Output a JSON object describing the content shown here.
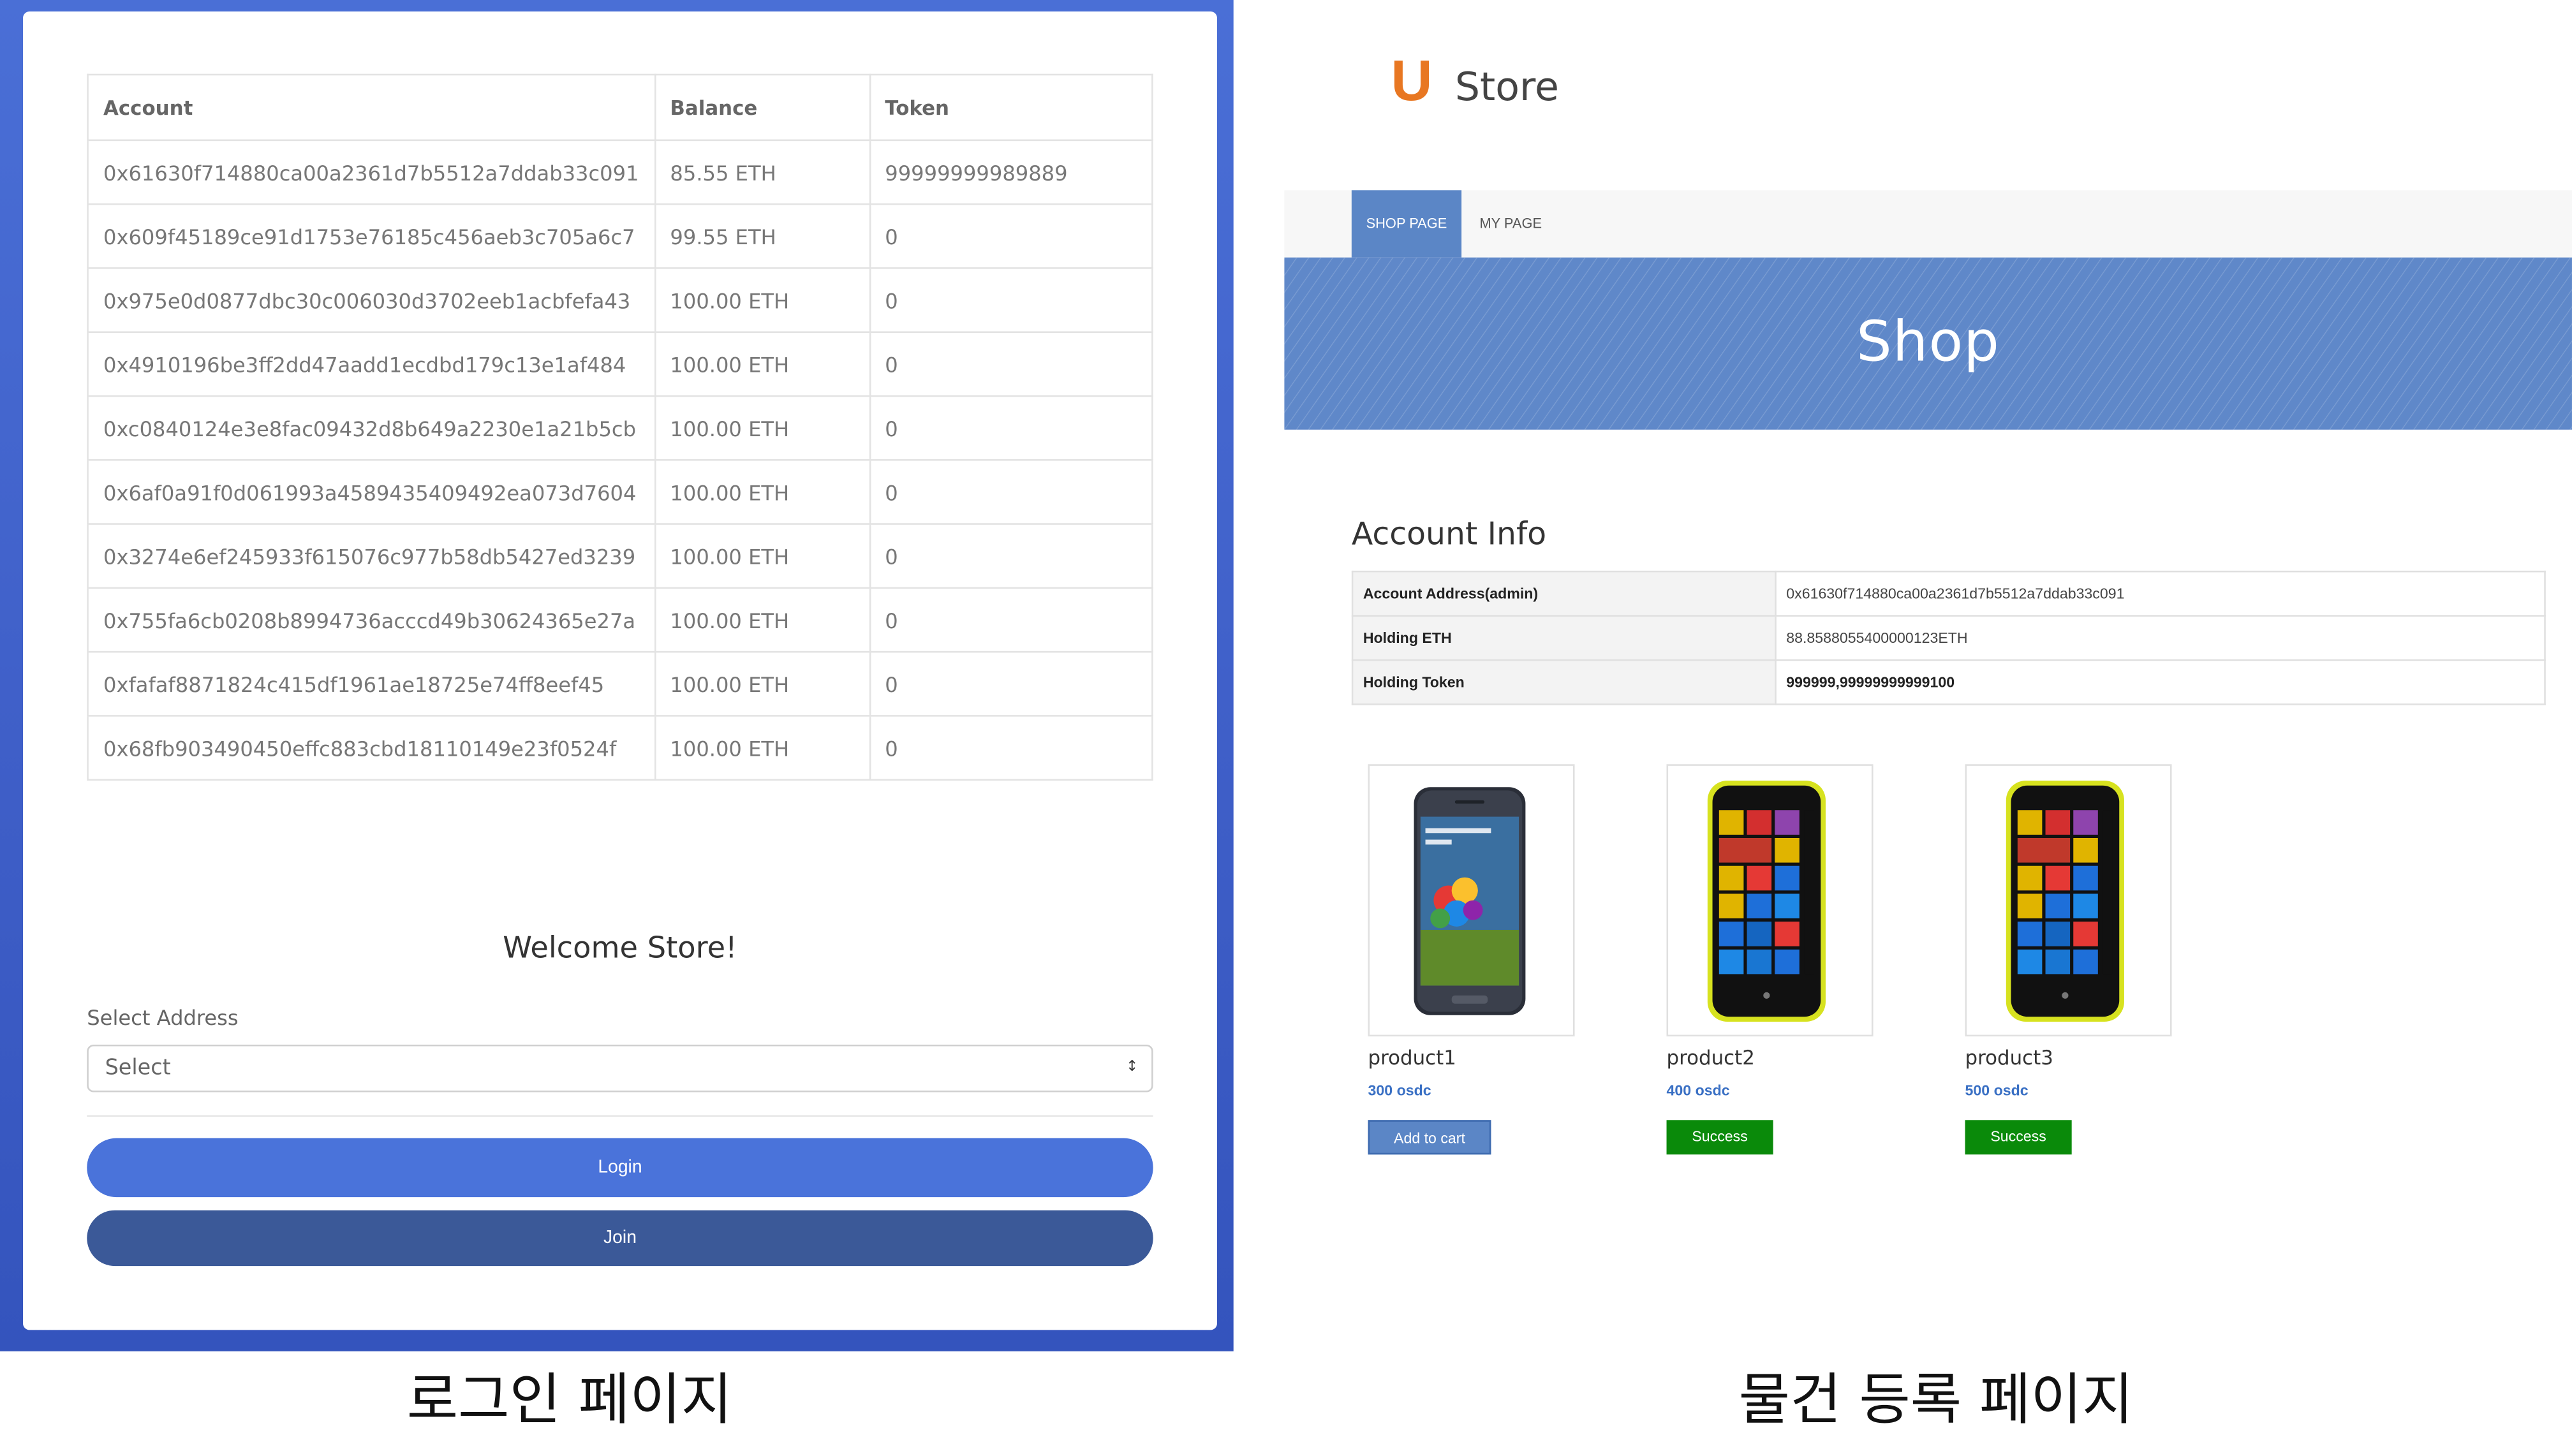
{
  "login_page": {
    "table": {
      "headers": [
        "Account",
        "Balance",
        "Token"
      ],
      "rows": [
        [
          "0x61630f714880ca00a2361d7b5512a7ddab33c091",
          "85.55 ETH",
          "99999999989889"
        ],
        [
          "0x609f45189ce91d1753e76185c456aeb3c705a6c7",
          "99.55 ETH",
          "0"
        ],
        [
          "0x975e0d0877dbc30c006030d3702eeb1acbfefa43",
          "100.00 ETH",
          "0"
        ],
        [
          "0x4910196be3ff2dd47aadd1ecdbd179c13e1af484",
          "100.00 ETH",
          "0"
        ],
        [
          "0xc0840124e3e8fac09432d8b649a2230e1a21b5cb",
          "100.00 ETH",
          "0"
        ],
        [
          "0x6af0a91f0d061993a4589435409492ea073d7604",
          "100.00 ETH",
          "0"
        ],
        [
          "0x3274e6ef245933f615076c977b58db5427ed3239",
          "100.00 ETH",
          "0"
        ],
        [
          "0x755fa6cb0208b8994736acccd49b30624365e27a",
          "100.00 ETH",
          "0"
        ],
        [
          "0xfafaf8871824c415df1961ae18725e74ff8eef45",
          "100.00 ETH",
          "0"
        ],
        [
          "0x68fb903490450effc883cbd18110149e23f0524f",
          "100.00 ETH",
          "0"
        ]
      ]
    },
    "welcome": "Welcome Store!",
    "select_label": "Select Address",
    "select_value": "Select",
    "login_label": "Login",
    "join_label": "Join",
    "caption": "로그인 페이지",
    "frame_color": "#4a6fd6"
  },
  "store_page": {
    "logo_letter": "U",
    "logo_text": "Store",
    "nav": {
      "tabs": [
        {
          "label": "SHOP PAGE",
          "active": true
        },
        {
          "label": "MY PAGE",
          "active": false
        }
      ]
    },
    "banner_title": "Shop",
    "account_heading": "Account Info",
    "account_info": [
      {
        "key": "Account Address(admin)",
        "value": "0x61630f714880ca00a2361d7b5512a7ddab33c091"
      },
      {
        "key": "Holding ETH",
        "value": "88.8588055400000123ETH"
      },
      {
        "key": "Holding Token",
        "value": "999999,99999999999100"
      }
    ],
    "products": [
      {
        "name": "product1",
        "price": "300 osdc",
        "button": "Add to cart",
        "button_type": "cart",
        "image": "samsung-phone-icon"
      },
      {
        "name": "product2",
        "price": "400 osdc",
        "button": "Success",
        "button_type": "success",
        "image": "lumia-phone-icon"
      },
      {
        "name": "product3",
        "price": "500 osdc",
        "button": "Success",
        "button_type": "success",
        "image": "lumia-phone-icon"
      }
    ],
    "caption": "물건 등록 페이지",
    "accent_color": "#5b86c6",
    "success_color": "#0a8a0a",
    "logo_color": "#e87722"
  }
}
